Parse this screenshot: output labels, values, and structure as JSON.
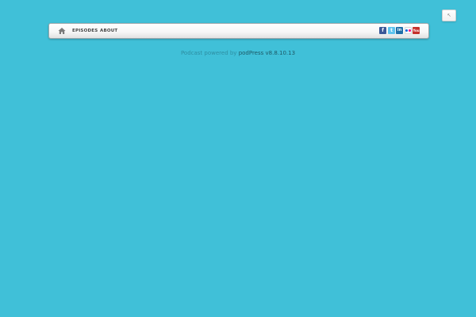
{
  "corner_button": {
    "icon": "resize-arrow-icon",
    "glyph": "↖"
  },
  "nav": {
    "home_icon": "home-icon",
    "items": [
      {
        "label": "EPISODES"
      },
      {
        "label": "ABOUT"
      }
    ],
    "social": [
      {
        "name": "facebook",
        "icon": "facebook-icon",
        "glyph": "f",
        "color": "#3b5998"
      },
      {
        "name": "twitter",
        "icon": "twitter-icon",
        "glyph": "t",
        "color": "#5ec3ee"
      },
      {
        "name": "linkedin",
        "icon": "linkedin-icon",
        "glyph": "in",
        "color": "#1f6fa8"
      },
      {
        "name": "flickr",
        "icon": "flickr-icon",
        "color": "#0063dc"
      },
      {
        "name": "youtube",
        "icon": "youtube-icon",
        "glyph": "You",
        "color": "#c4302b"
      }
    ]
  },
  "footer": {
    "prefix": "Podcast powered by",
    "link_text": "podPress v8.8.10.13"
  },
  "colors": {
    "background": "#40c0d8",
    "navbar": "#f4f4f4",
    "footer_text": "#2d8ea2",
    "footer_link": "#1d5866"
  }
}
